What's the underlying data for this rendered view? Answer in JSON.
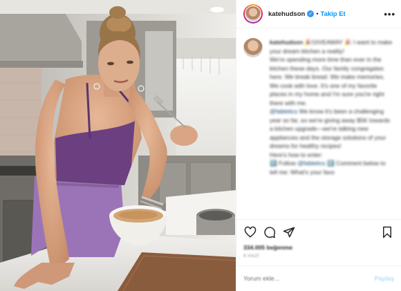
{
  "post": {
    "header": {
      "username": "katehudson",
      "separator": "•",
      "follow_label": "Takip Et",
      "more_label": "•••"
    },
    "caption": {
      "username": "katehudson",
      "intro": "🎉GIVEAWAY 🎉 I want to make your dream kitchen a reality!",
      "body": "We're spending more time than ever in the kitchen these days. Our family congregates here. We break bread. We make memories. We cook with love. It's one of my favorite places in my home and I'm sure you're right there with me.",
      "mention": "@fabletics",
      "mention_text": " We know it's been a challenging year so far, so we're giving away $5K towards a kitchen upgrade—we're talking new appliances and the storage solutions of your dreams for healthy recipes!",
      "how_to": "Here's how to enter:",
      "step1_prefix": "1️⃣ Follow ",
      "step1_mention": "@fabletics",
      "step2": " 2️⃣ Comment below to tell me: What's your favo"
    },
    "likes": "334.005 beğenme",
    "date": "6 HAZİ",
    "comment": {
      "placeholder": "Yorum ekle...",
      "post_label": "Paylaş"
    }
  },
  "colors": {
    "accent": "#0095f6",
    "verified": "#3897f0",
    "border": "#efefef",
    "muted": "#8e8e8e"
  },
  "icons": [
    "verified-badge-icon",
    "heart-icon",
    "comment-icon",
    "share-icon",
    "bookmark-icon"
  ]
}
